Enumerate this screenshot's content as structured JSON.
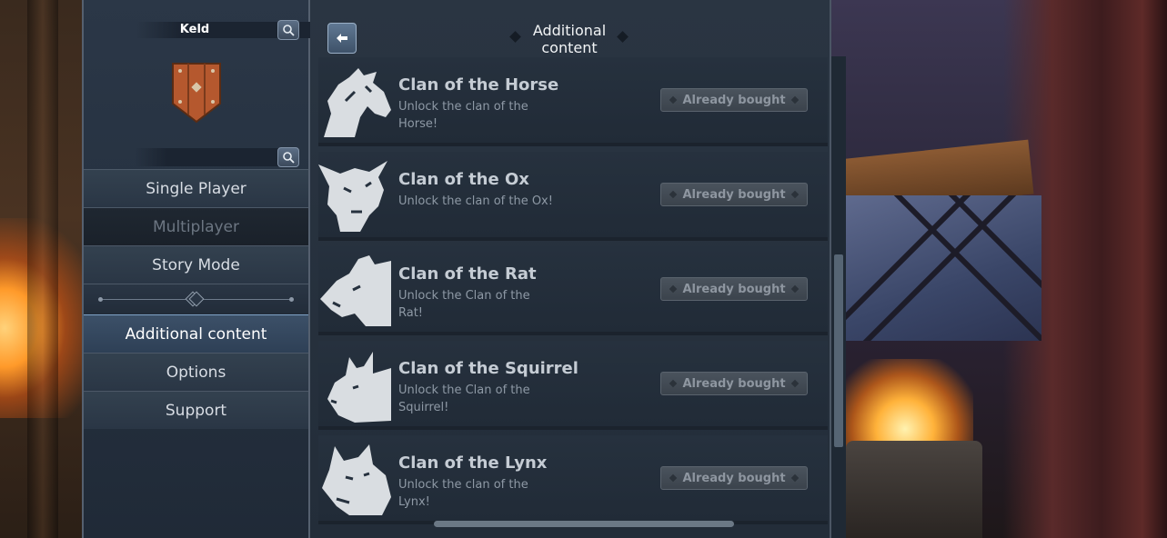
{
  "player": {
    "name": "Keld"
  },
  "menu": {
    "items": [
      {
        "label": "Single Player",
        "state": "normal"
      },
      {
        "label": "Multiplayer",
        "state": "disabled"
      },
      {
        "label": "Story Mode",
        "state": "normal"
      },
      {
        "label": "Additional content",
        "state": "active"
      },
      {
        "label": "Options",
        "state": "normal"
      },
      {
        "label": "Support",
        "state": "normal"
      }
    ]
  },
  "header": {
    "title_line1": "Additional",
    "title_line2": "content"
  },
  "dlc": [
    {
      "name": "Clan of the Horse",
      "description": "Unlock the clan of the Horse!",
      "button": "Already bought",
      "icon": "horse-icon"
    },
    {
      "name": "Clan of the Ox",
      "description": "Unlock the clan of the Ox!",
      "button": "Already bought",
      "icon": "ox-icon"
    },
    {
      "name": "Clan of the Rat",
      "description": "Unlock the Clan of the Rat!",
      "button": "Already bought",
      "icon": "rat-icon"
    },
    {
      "name": "Clan of the Squirrel",
      "description": "Unlock the Clan of the Squirrel!",
      "button": "Already bought",
      "icon": "squirrel-icon"
    },
    {
      "name": "Clan of the Lynx",
      "description": "Unlock the clan of the Lynx!",
      "button": "Already bought",
      "icon": "lynx-icon"
    }
  ],
  "colors": {
    "accent": "#7fa3c7",
    "panel": "#26313e",
    "emblem": "#b5582e"
  }
}
